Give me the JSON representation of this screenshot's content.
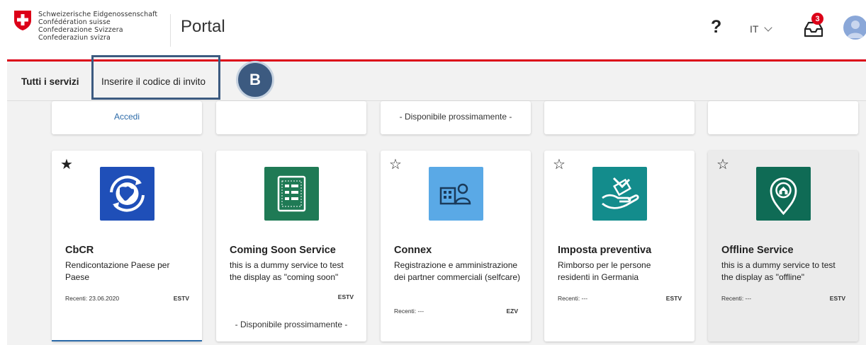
{
  "header": {
    "confederation": [
      "Schweizerische Eidgenossenschaft",
      "Confédération suisse",
      "Confederazione Svizzera",
      "Confederaziun svizra"
    ],
    "title": "Portal",
    "help_symbol": "?",
    "language": "IT",
    "inbox_count": "3",
    "icons": {
      "help": "question-mark-icon",
      "inbox": "inbox-tray-icon",
      "avatar": "user-avatar-icon",
      "language_caret": "chevron-down-icon"
    }
  },
  "tabs": [
    {
      "label": "Tutti i servizi",
      "active": true
    },
    {
      "label": "Inserire il codice di invito",
      "active": false
    }
  ],
  "annotation": {
    "marker": "B"
  },
  "top_row": {
    "accedi": "Accedi",
    "coming_soon": "- Disponibile prossimamente -"
  },
  "services": [
    {
      "title": "CbCR",
      "description": "Rendicontazione Paese per Paese",
      "recent": "Recenti: 23.06.2020",
      "owner": "ESTV",
      "favorite": true,
      "icon": "globe-sync-icon",
      "icon_color": "#1f4fb8"
    },
    {
      "title": "Coming Soon Service",
      "description": "this is a dummy service to test the display as \"coming soon\"",
      "recent": "",
      "owner": "ESTV",
      "status": "- Disponibile prossimamente -",
      "favorite": false,
      "icon": "form-document-icon",
      "icon_color": "#1f7a55"
    },
    {
      "title": "Connex",
      "description": "Registrazione e amministrazione dei partner commerciali (selfcare)",
      "recent": "Recenti: ---",
      "owner": "EZV",
      "favorite": false,
      "icon": "building-person-icon",
      "icon_color": "#5aa9e6"
    },
    {
      "title": "Imposta preventiva",
      "description": "Rimborso per le persone residenti in Germania",
      "recent": "Recenti: ---",
      "owner": "ESTV",
      "favorite": false,
      "icon": "refund-hand-icon",
      "icon_color": "#138c8c"
    },
    {
      "title": "Offline Service",
      "description": "this is a dummy service to test the display as \"offline\"",
      "recent": "Recenti: ---",
      "owner": "ESTV",
      "favorite": false,
      "icon": "location-home-icon",
      "icon_color": "#0f6b55"
    }
  ]
}
